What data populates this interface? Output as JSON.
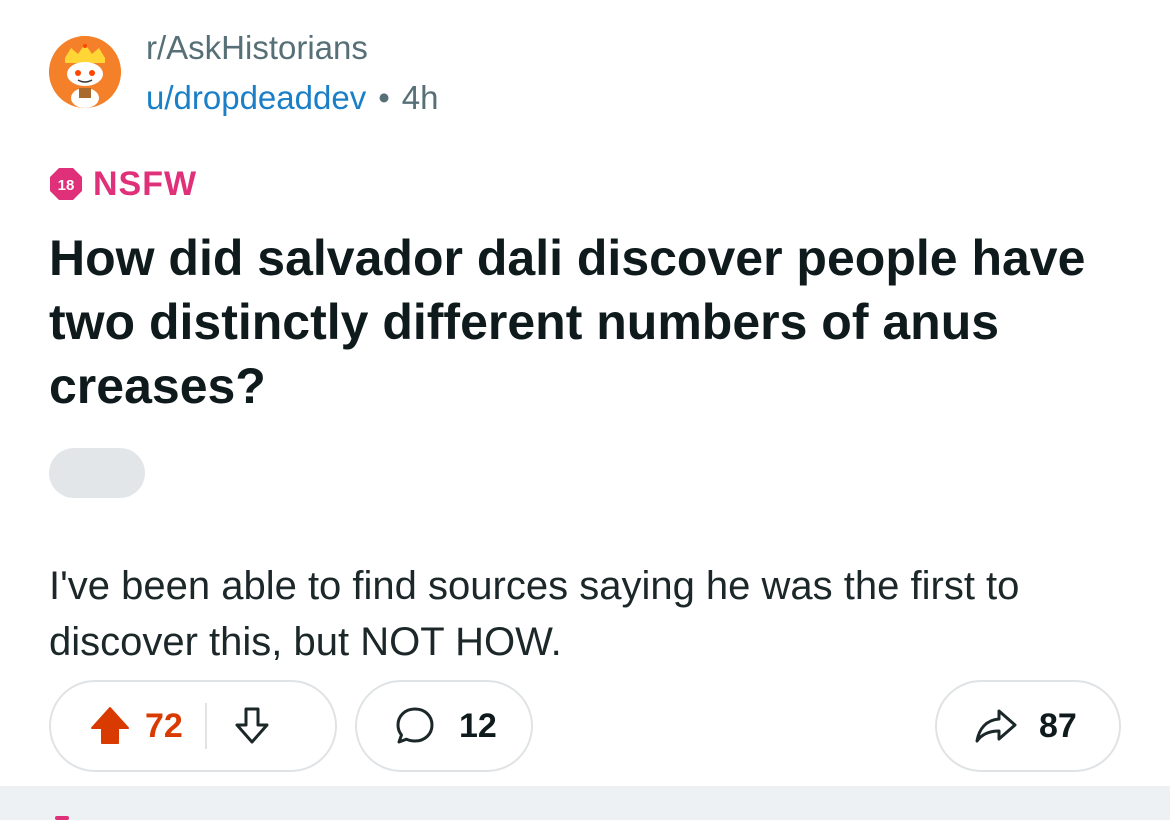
{
  "post": {
    "subreddit": "r/AskHistorians",
    "author": "u/dropdeaddev",
    "separator": "•",
    "age": "4h",
    "nsfw_badge_number": "18",
    "nsfw_label": "NSFW",
    "title": "How did salvador dali discover people have two distinctly different numbers of anus creases?",
    "body": "I've been able to find sources saying he was the first to discover this, but NOT HOW."
  },
  "actions": {
    "upvotes": "72",
    "comments": "12",
    "shares": "87"
  },
  "icons": {
    "avatar": "snoo-avatar-icon",
    "nsfw": "nsfw-18-icon",
    "upvote": "upvote-arrow-icon",
    "downvote": "downvote-arrow-icon",
    "comment": "comment-bubble-icon",
    "share": "share-arrow-icon"
  },
  "colors": {
    "upvote_active": "#d93a00",
    "nsfw": "#e0307a",
    "author_link": "#1a7fc7",
    "avatar_bg": "#f4812a"
  }
}
